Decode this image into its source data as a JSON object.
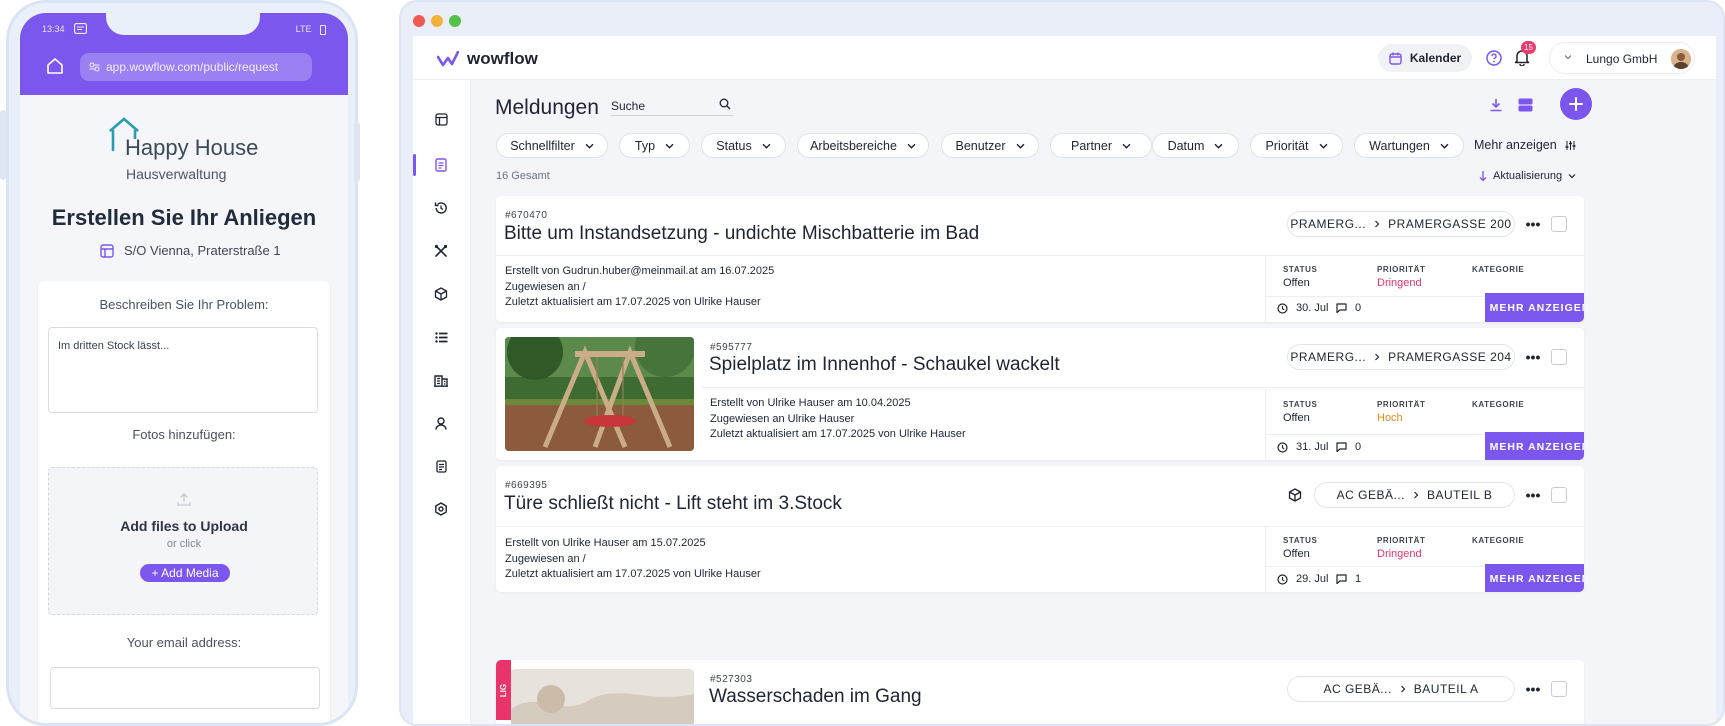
{
  "phone": {
    "status_time": "13:34",
    "status_network": "LTE",
    "url": "app.wowflow.com/public/request",
    "brand_name": "Happy House",
    "brand_sub": "Hausverwaltung",
    "title": "Erstellen Sie Ihr Anliegen",
    "location": "S/O Vienna, Praterstraße 1",
    "describe_label": "Beschreiben Sie Ihr Problem:",
    "describe_value": "Im dritten Stock lässt...",
    "photos_label": "Fotos hinzufügen:",
    "upload_title": "Add files to Upload",
    "upload_or": "or click",
    "add_media": "+ Add Media",
    "email_label": "Your email address:"
  },
  "app": {
    "brand": "wowflow",
    "calendar": "Kalender",
    "notifications": "15",
    "account": "Lungo GmbH",
    "page_title": "Meldungen",
    "search_placeholder": "Suche",
    "filters": [
      "Schnellfilter",
      "Typ",
      "Status",
      "Arbeitsbereiche",
      "Benutzer",
      "Partner",
      "Datum",
      "Priorität",
      "Wartungen"
    ],
    "more_filters": "Mehr anzeigen",
    "total": "16 Gesamt",
    "sort": "Aktualisierung",
    "col_status": "STATUS",
    "col_priority": "PRIORITÄT",
    "col_category": "KATEGORIE",
    "more_button": "MEHR ANZEIGEN",
    "accent": "#7b57ee",
    "urgent_color": "#e0336b",
    "high_color": "#e88a1a"
  },
  "cards": [
    {
      "id": "#670470",
      "title": "Bitte um Instandsetzung - undichte Mischbatterie im Bad",
      "loc_a": "PRAMERG...",
      "loc_b": "PRAMERGASSE 200",
      "created_prefix": "Erstellt von",
      "created_by": "Gudrun.huber@meinmail.at",
      "created_mid": "am",
      "created_date": "16.07.2025",
      "assigned_prefix": "Zugewiesen an",
      "assigned_to": "/",
      "updated_prefix": "Zuletzt aktualisiert am",
      "updated_date": "17.07.2025",
      "updated_mid": "von",
      "updated_by": "Ulrike Hauser",
      "status": "Offen",
      "priority": "Dringend",
      "due": "30. Jul",
      "comments": "0"
    },
    {
      "id": "#595777",
      "title": "Spielplatz im Innenhof - Schaukel wackelt",
      "loc_a": "PRAMERG...",
      "loc_b": "PRAMERGASSE 204",
      "created_prefix": "Erstellt von",
      "created_by": "Ulrike Hauser",
      "created_mid": "am",
      "created_date": "10.04.2025",
      "assigned_prefix": "Zugewiesen an",
      "assigned_to": "Ulrike Hauser",
      "updated_prefix": "Zuletzt aktualisiert am",
      "updated_date": "17.07.2025",
      "updated_mid": "von",
      "updated_by": "Ulrike Hauser",
      "status": "Offen",
      "priority": "Hoch",
      "due": "31. Jul",
      "comments": "0"
    },
    {
      "id": "#669395",
      "title": "Türe schließt nicht - Lift steht im 3.Stock",
      "loc_a": "AC GEBÄ...",
      "loc_b": "BAUTEIL B",
      "created_prefix": "Erstellt von",
      "created_by": "Ulrike Hauser",
      "created_mid": "am",
      "created_date": "15.07.2025",
      "assigned_prefix": "Zugewiesen an",
      "assigned_to": "/",
      "updated_prefix": "Zuletzt aktualisiert am",
      "updated_date": "17.07.2025",
      "updated_mid": "von",
      "updated_by": "Ulrike Hauser",
      "status": "Offen",
      "priority": "Dringend",
      "due": "29. Jul",
      "comments": "1"
    },
    {
      "id": "#527303",
      "title": "Wasserschaden im Gang",
      "loc_a": "AC GEBÄ...",
      "loc_b": "BAUTEIL A",
      "tag": "LIG"
    }
  ]
}
